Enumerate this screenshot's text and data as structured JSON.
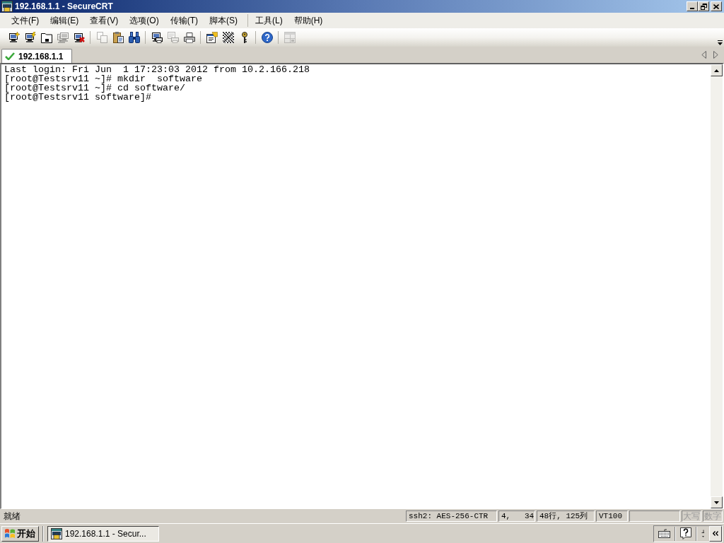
{
  "window": {
    "title": "192.168.1.1 - SecureCRT"
  },
  "menu": [
    [
      "文件(F)",
      "编辑(E)",
      "查看(V)",
      "选项(O)",
      "传输(T)",
      "脚本(S)"
    ],
    [
      "工具(L)",
      "帮助(H)"
    ]
  ],
  "toolbar": [
    [
      {
        "disabled": false
      },
      {
        "disabled": false
      },
      {
        "disabled": false
      },
      {
        "disabled": true
      },
      {
        "disabled": false
      }
    ],
    [
      {
        "disabled": true
      },
      {
        "disabled": false
      },
      {
        "disabled": false
      }
    ],
    [
      {
        "disabled": false
      },
      {
        "disabled": true
      },
      {
        "disabled": false
      }
    ],
    [
      {
        "disabled": false
      },
      {
        "disabled": false
      },
      {
        "disabled": false
      }
    ],
    [
      {
        "disabled": false
      }
    ],
    [
      {
        "disabled": true
      }
    ]
  ],
  "tabs": [
    {
      "label": "192.168.1.1",
      "selected": true,
      "connected": true
    }
  ],
  "terminal": {
    "lines": [
      "Last login: Fri Jun  1 17:23:03 2012 from 10.2.166.218",
      "[root@Testsrv11 ~]# mkdir  software",
      "[root@Testsrv11 ~]# cd software/",
      "[root@Testsrv11 software]#"
    ]
  },
  "status_bar": {
    "message": "就绪",
    "panels": [
      "ssh2: AES-256-CTR",
      "4,   34",
      "48行, 125列",
      "VT100"
    ],
    "indicators": [
      {
        "label": "大写",
        "on": false
      },
      {
        "label": "数字",
        "on": false
      }
    ]
  },
  "taskbar": {
    "start": "开始",
    "windows": [
      {
        "label": "192.168.1.1 - Secur...",
        "selected": true
      }
    ]
  }
}
